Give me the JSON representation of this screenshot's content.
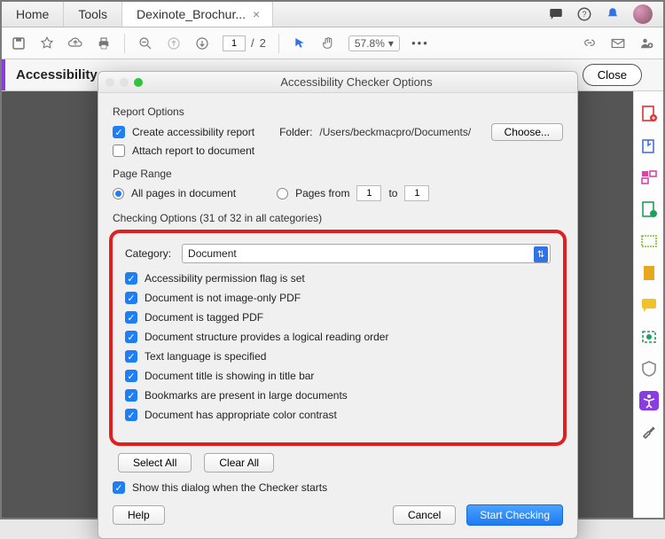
{
  "menu": {
    "home": "Home",
    "tools": "Tools",
    "doc": "Dexinote_Brochur..."
  },
  "toolbar": {
    "page": "1",
    "pages": "2",
    "slash": "/",
    "zoom": "57.8%"
  },
  "panel": {
    "title": "Accessibility",
    "close": "Close"
  },
  "modal": {
    "title": "Accessibility Checker Options",
    "report_section": "Report Options",
    "create_report": "Create accessibility report",
    "folder_label": "Folder:",
    "folder_path": "/Users/beckmacpro/Documents/",
    "choose": "Choose...",
    "attach": "Attach report to document",
    "pagerange_section": "Page Range",
    "all_pages": "All pages in document",
    "pages_from_label": "Pages from",
    "pages_from": "1",
    "to": "to",
    "pages_to": "1",
    "checking_section": "Checking Options (31 of 32 in all categories)",
    "category_label": "Category:",
    "category_value": "Document",
    "checks": [
      "Accessibility permission flag is set",
      "Document is not image-only PDF",
      "Document is tagged PDF",
      "Document structure provides a logical reading order",
      "Text language is specified",
      "Document title is showing in title bar",
      "Bookmarks are present in large documents",
      "Document has appropriate color contrast"
    ],
    "select_all": "Select All",
    "clear_all": "Clear All",
    "show_dialog": "Show this dialog when the Checker starts",
    "help": "Help",
    "cancel": "Cancel",
    "start": "Start Checking"
  }
}
